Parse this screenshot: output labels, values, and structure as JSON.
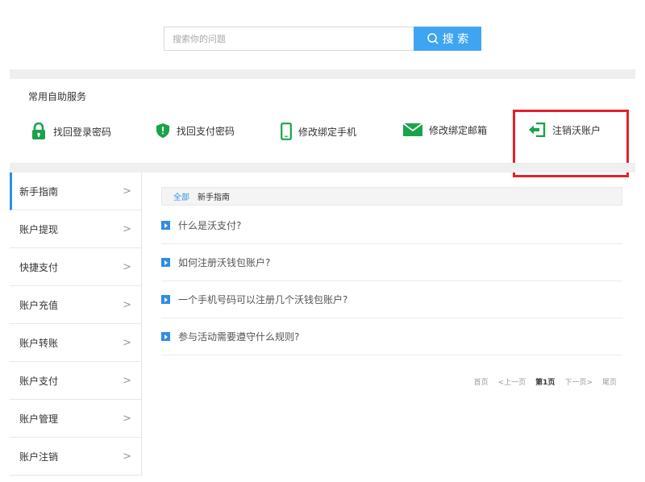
{
  "search": {
    "placeholder": "搜索你的问题",
    "button_label": "搜 索"
  },
  "services": {
    "title": "常用自助服务",
    "items": [
      {
        "label": "找回登录密码",
        "icon": "lock-icon",
        "color": "#1aa34a"
      },
      {
        "label": "找回支付密码",
        "icon": "shield-icon",
        "color": "#1aa34a"
      },
      {
        "label": "修改绑定手机",
        "icon": "phone-icon",
        "color": "#1aa34a"
      },
      {
        "label": "修改绑定邮箱",
        "icon": "mail-icon",
        "color": "#1aa34a"
      },
      {
        "label": "注销沃账户",
        "icon": "sign-out-icon",
        "color": "#1aa34a"
      }
    ]
  },
  "sidebar": {
    "items": [
      {
        "label": "新手指南"
      },
      {
        "label": "账户提现"
      },
      {
        "label": "快捷支付"
      },
      {
        "label": "账户充值"
      },
      {
        "label": "账户转账"
      },
      {
        "label": "账户支付"
      },
      {
        "label": "账户管理"
      },
      {
        "label": "账户注销"
      }
    ],
    "chevron": ">"
  },
  "breadcrumb": {
    "all": "全部",
    "current": "新手指南"
  },
  "questions": [
    "什么是沃支付?",
    "如何注册沃钱包账户?",
    "一个手机号码可以注册几个沃钱包账户?",
    "参与活动需要遵守什么规则?"
  ],
  "pager": {
    "first": "首页",
    "prev": "<上一页",
    "current": "第1页",
    "next": "下一页>",
    "last": "尾页"
  },
  "colors": {
    "accent": "#3fa5f0",
    "green": "#1aa34a",
    "highlight": "#e3222a"
  }
}
